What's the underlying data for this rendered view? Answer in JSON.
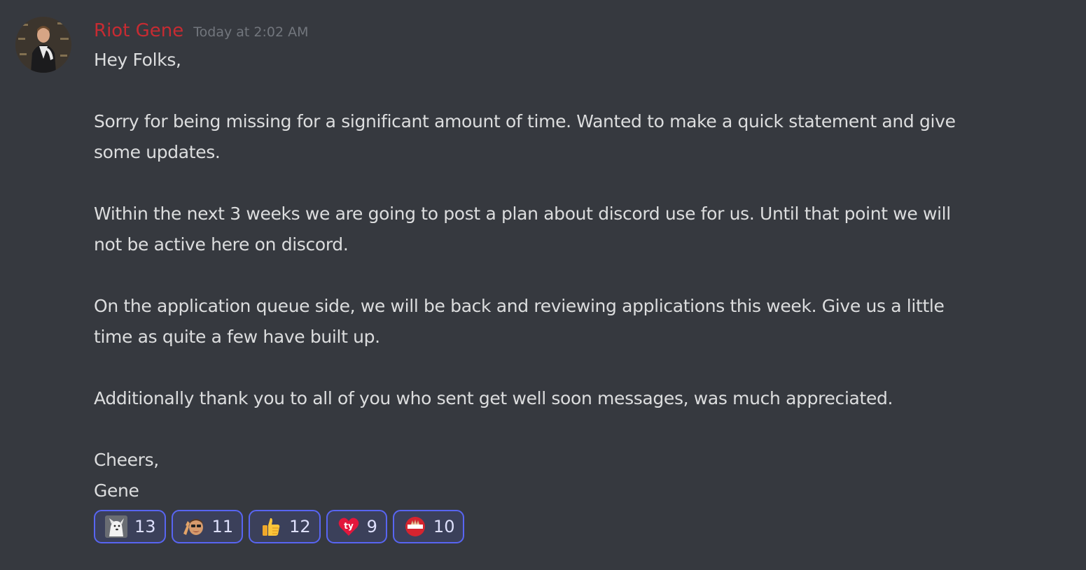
{
  "message": {
    "author": "Riot Gene",
    "author_color": "#c72b32",
    "timestamp": "Today at 2:02 AM",
    "lines": {
      "greeting": "Hey Folks,",
      "p1_line1": "Sorry for being missing for a significant amount of time. Wanted to make a quick statement and give",
      "p1_line2": "some updates.",
      "p2_line1": "Within the next 3 weeks we are going to post a plan about discord use for us. Until that point we will",
      "p2_line2": "not be active here on discord.",
      "p3_line1": "On the application queue side, we will be back and reviewing applications this week. Give us a little",
      "p3_line2": "time as quite a few have built up.",
      "p4_line1": "Additionally thank you to all of you who sent get well soon messages, was much appreciated.",
      "signoff1": "Cheers,",
      "signoff2": "Gene"
    }
  },
  "reactions": [
    {
      "emoji": "dog-emoji",
      "count": "13"
    },
    {
      "emoji": "face-wave-emoji",
      "count": "11"
    },
    {
      "emoji": "thumbs-up-emoji",
      "count": "12"
    },
    {
      "emoji": "ty-heart-emoji",
      "count": "9"
    },
    {
      "emoji": "no-entry-hand-emoji",
      "count": "10"
    }
  ],
  "colors": {
    "background": "#36393f",
    "text": "#dcddde",
    "timestamp": "#72767d",
    "reaction_border": "#5865f2",
    "reaction_bg": "#3b405a"
  }
}
